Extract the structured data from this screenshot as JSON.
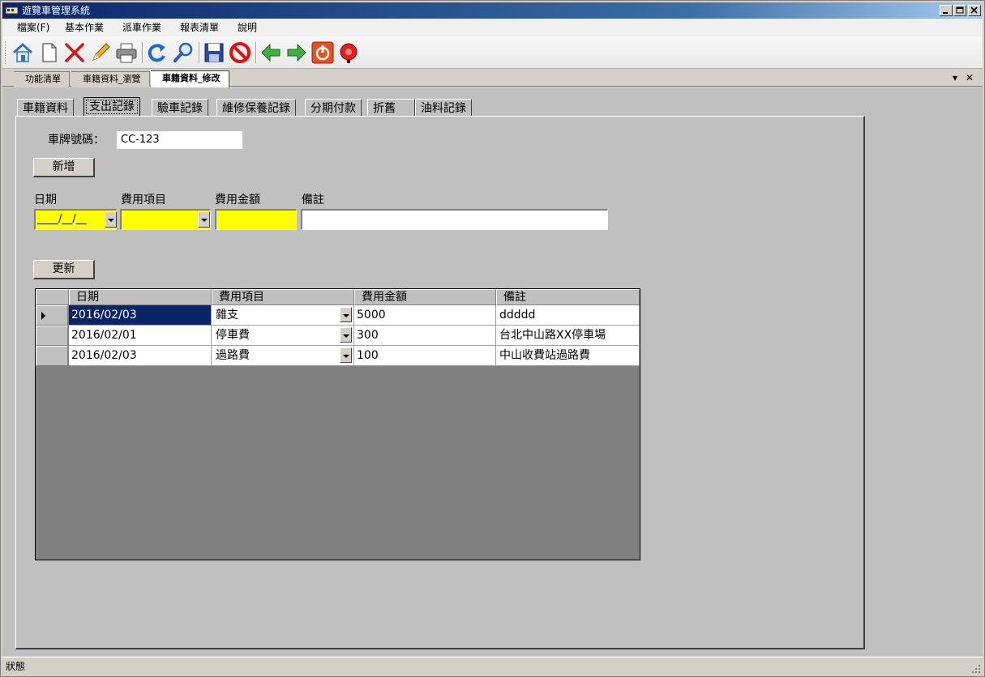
{
  "window": {
    "title": "遊覽車管理系統"
  },
  "menu": {
    "items": [
      "檔案(F)",
      "基本作業",
      "派車作業",
      "報表清單",
      "說明"
    ]
  },
  "toolbar": {
    "buttons": [
      "home-icon",
      "new-document-icon",
      "delete-icon",
      "edit-pencil-icon",
      "print-icon",
      "refresh-icon",
      "search-magnifier-icon",
      "save-floppy-icon",
      "cancel-icon",
      "back-arrow-icon",
      "forward-arrow-icon",
      "power-icon",
      "alarm-bell-icon"
    ]
  },
  "mdi_tabs": {
    "items": [
      "功能清單",
      "車籍資料_瀏覽",
      "車籍資料_修改"
    ],
    "active_index": 2
  },
  "inner_tabs": {
    "items": [
      "車籍資料",
      "支出記錄",
      "驗車記錄",
      "維修保養記錄",
      "分期付款",
      "折舊",
      "油料記錄"
    ],
    "active_index": 1
  },
  "form": {
    "plate_label": "車牌號碼：",
    "plate_value": "CC-123",
    "add_button": "新增",
    "date_label": "日期",
    "date_value": "____/__/__",
    "item_label": "費用項目",
    "amount_label": "費用金額",
    "note_label": "備註",
    "update_button": "更新"
  },
  "grid": {
    "columns": [
      "日期",
      "費用項目",
      "費用金額",
      "備註"
    ],
    "rows": [
      {
        "date": "2016/02/03",
        "item": "雜支",
        "amount": "5000",
        "note": "ddddd"
      },
      {
        "date": "2016/02/01",
        "item": "停車費",
        "amount": "300",
        "note": "台北中山路XX停車場"
      },
      {
        "date": "2016/02/03",
        "item": "過路費",
        "amount": "100",
        "note": "中山收費站過路費"
      }
    ],
    "selected_row": 0
  },
  "status": {
    "text": "狀態"
  },
  "colors": {
    "title_bar": "#0a246a",
    "required_field": "#ffff00",
    "selection": "#0a246a"
  }
}
